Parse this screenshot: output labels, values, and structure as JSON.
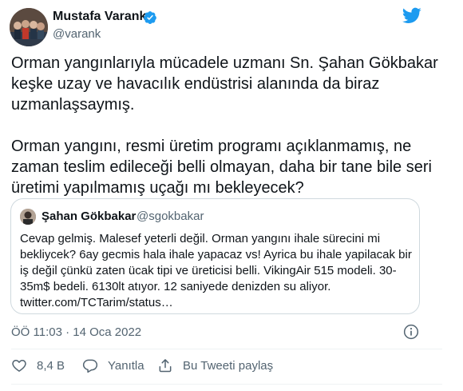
{
  "author": {
    "name": "Mustafa Varank",
    "handle": "@varank"
  },
  "tweet": {
    "paragraphs": [
      "Orman yangınlarıyla mücadele uzmanı Sn. Şahan Gökbakar keşke uzay ve havacılık endüstrisi alanında da biraz uzmanlaşsaymış.",
      "Orman yangını, resmi üretim programı açıklanmamış, ne zaman teslim edileceği belli olmayan, daha bir tane bile seri üretimi yapılmamış uçağı mı bekleyecek?"
    ]
  },
  "quote": {
    "name": "Şahan Gökbakar",
    "handle": "@sgokbakar",
    "text": "Cevap gelmiş. Malesef yeterli değil. Orman yangını ihale sürecini mi bekliycek? 6ay gecmis hala ihale yapacaz vs! Ayrica bu ihale yapilacak bir iş değil çünkü zaten ücak tipi ve üreticisi belli. VikingAir 515 modeli. 30-35m$ bedeli. 6130lt atıyor. 12 saniyede denizden su aliyor. twitter.com/TCTarim/status…"
  },
  "timestamp": "ÖÖ 11:03 · 14 Oca 2022",
  "actions": {
    "likes": "8,4 B",
    "reply": "Yanıtla",
    "share": "Bu Tweeti paylaş"
  },
  "icons": {
    "verified": "verified-badge-icon",
    "brand": "twitter-bird-icon",
    "info": "info-icon",
    "like": "heart-icon",
    "reply": "reply-bubble-icon",
    "share": "share-upload-icon"
  },
  "colors": {
    "brand_blue": "#1d9bf0",
    "secondary_text": "#536471",
    "border": "#cfd9de"
  }
}
